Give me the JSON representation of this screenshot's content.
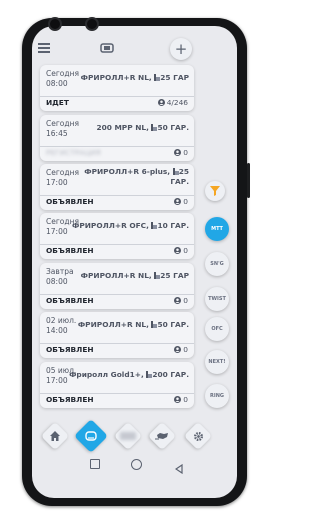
{
  "cards": [
    {
      "date": "Сегодня",
      "time": "08:00",
      "title": "ФРИРОЛЛ+R NL, ",
      "title_suffix": "25 ГАР",
      "status": "ИДЕТ",
      "count": "4/246",
      "blur": false
    },
    {
      "date": "Сегодня",
      "time": "16:45",
      "title": "200 МРР NL, ",
      "title_suffix": "50 ГАР.",
      "status": "РЕГИСТРАЦИЯ",
      "count": "0",
      "blur": true
    },
    {
      "date": "Сегодня",
      "time": "17:00",
      "title": "ФРИРОЛЛ+R 6-plus, ",
      "title_suffix": "25 ГАР.",
      "status": "ОБЪЯВЛЕН",
      "count": "0",
      "blur": false
    },
    {
      "date": "Сегодня",
      "time": "17:00",
      "title": "ФРИРОЛЛ+R OFC, ",
      "title_suffix": "10 ГАР.",
      "status": "ОБЪЯВЛЕН",
      "count": "0",
      "blur": false
    },
    {
      "date": "Завтра",
      "time": "08:00",
      "title": "ФРИРОЛЛ+R NL, ",
      "title_suffix": "25 ГАР",
      "status": "ОБЪЯВЛЕН",
      "count": "0",
      "blur": false
    },
    {
      "date": "02 июл.",
      "time": "14:00",
      "title": "ФРИРОЛЛ+R NL, ",
      "title_suffix": "50 ГАР.",
      "status": "ОБЪЯВЛЕН",
      "count": "0",
      "blur": false
    },
    {
      "date": "05 июл.",
      "time": "17:00",
      "title": "Фриролл Gold1+, ",
      "title_suffix": "200 ГАР.",
      "status": "ОБЪЯВЛЕН",
      "count": "0",
      "blur": false
    }
  ],
  "side_tabs": [
    "МТТ",
    "SN'G",
    "TWIST",
    "OFC",
    "NEXT!",
    "RING"
  ],
  "active_side_tab": "МТТ",
  "colors": {
    "accent": "#21a7e6",
    "filter": "#f5a623",
    "background": "#e9eaee"
  },
  "icons": [
    "plus-icon",
    "filter-icon",
    "home-icon",
    "chip-icon",
    "blurred-icon",
    "map-icon",
    "gear-icon"
  ]
}
